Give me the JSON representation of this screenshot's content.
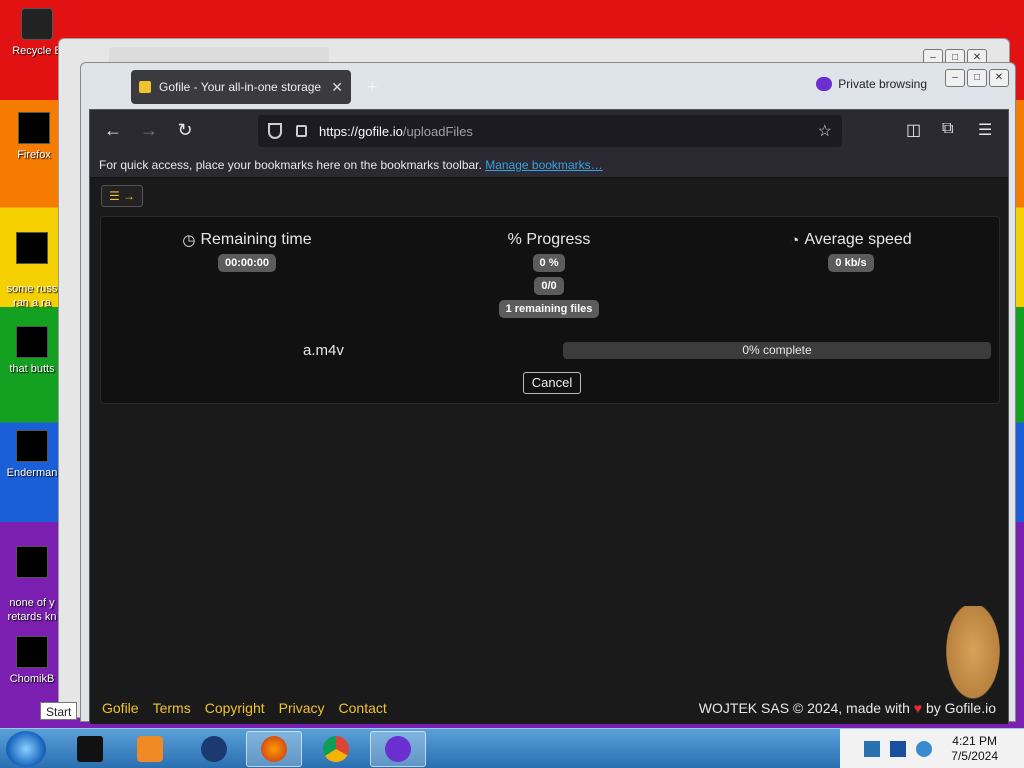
{
  "desktop": {
    "icons": [
      {
        "label": "Recycle B"
      },
      {
        "label": "Firefox"
      },
      {
        "label": "some russ\nran a ra"
      },
      {
        "label": "that butts"
      },
      {
        "label": "Enderman"
      },
      {
        "label": "none of y\nretards kn"
      },
      {
        "label": "ChomikB"
      }
    ]
  },
  "browser": {
    "tab_title": "Gofile - Your all-in-one storage",
    "private_label": "Private browsing",
    "url_host": "https://gofile.io",
    "url_path": "/uploadFiles",
    "bookmarks_text": "For quick access, place your bookmarks here on the bookmarks toolbar.",
    "bookmarks_link": "Manage bookmarks…"
  },
  "upload": {
    "remaining_time_label": "Remaining time",
    "remaining_time_value": "00:00:00",
    "progress_label": "% Progress",
    "progress_percent": "0 %",
    "progress_count": "0/0",
    "remaining_files": "1 remaining files",
    "speed_label": "Average speed",
    "speed_value": "0 kb/s",
    "file_name": "a.m4v",
    "file_progress_text": "0% complete",
    "file_progress_fraction": 0,
    "cancel_label": "Cancel"
  },
  "footer": {
    "links": [
      "Gofile",
      "Terms",
      "Copyright",
      "Privacy",
      "Contact"
    ],
    "copyright_prefix": "WOJTEK SAS © 2024, made with",
    "copyright_suffix": "by Gofile.io"
  },
  "taskbar": {
    "start_tooltip": "Start",
    "time": "4:21 PM",
    "date": "7/5/2024"
  },
  "colors": {
    "accent": "#f1c232",
    "link": "#3aa0e0",
    "heart": "#e03030"
  }
}
